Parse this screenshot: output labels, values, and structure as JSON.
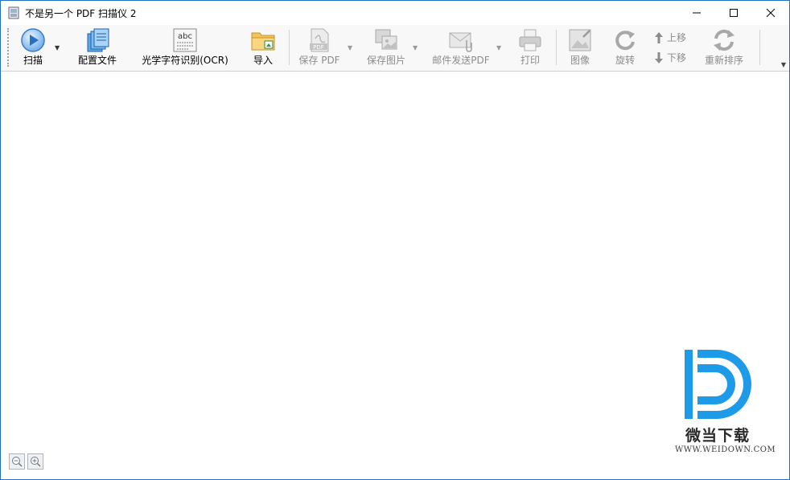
{
  "window": {
    "title": "不是另一个 PDF 扫描仪 2"
  },
  "toolbar": {
    "scan": "扫描",
    "profiles": "配置文件",
    "ocr": "光学字符识别(OCR)",
    "import": "导入",
    "save_pdf": "保存 PDF",
    "save_images": "保存图片",
    "email_pdf": "邮件发送PDF",
    "print": "打印",
    "image": "图像",
    "rotate": "旋转",
    "move_up": "上移",
    "move_down": "下移",
    "reorder": "重新排序"
  },
  "icons": {
    "ocr_text": "abc",
    "pdf_text": "PDF"
  },
  "watermark": {
    "name": "微当下载",
    "url": "WWW.WEIDOWN.COM"
  },
  "colors": {
    "accent": "#1f6fc4",
    "watermark_blue": "#1e9be8"
  }
}
